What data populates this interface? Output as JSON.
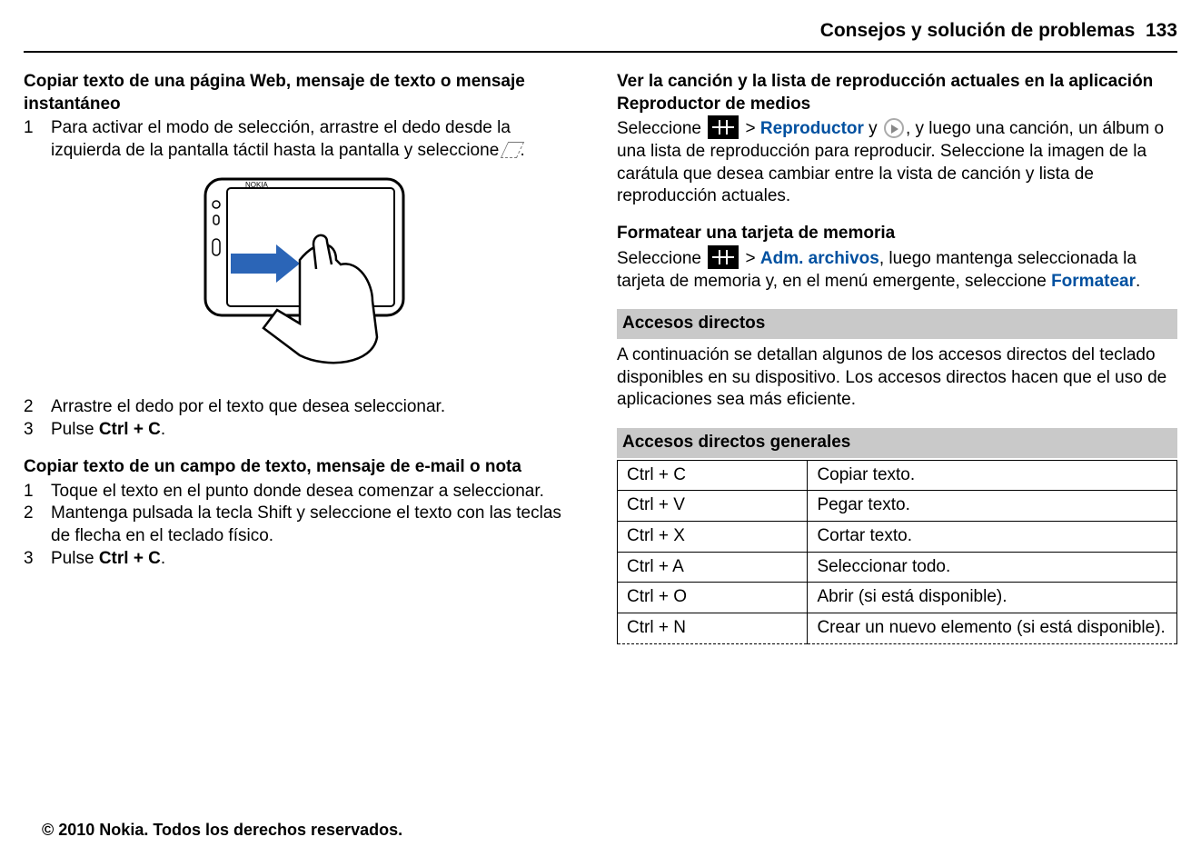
{
  "header": {
    "section": "Consejos y solución de problemas",
    "page": "133"
  },
  "left": {
    "h1": "Copiar texto de una página Web, mensaje de texto o mensaje instantáneo",
    "step1": "Para activar el modo de selección, arrastre el dedo desde la izquierda de la pantalla táctil hasta la pantalla y seleccione ",
    "step2": "Arrastre el dedo por el texto que desea seleccionar.",
    "step3a": "Pulse ",
    "step3b": "Ctrl + C",
    "h2": "Copiar texto de un campo de texto, mensaje de e-mail o nota",
    "b_step1": "Toque el texto en el punto donde desea comenzar a seleccionar.",
    "b_step2": "Mantenga pulsada la tecla Shift y seleccione el texto con las teclas de flecha en el teclado físico.",
    "b_step3a": "Pulse ",
    "b_step3b": "Ctrl + C"
  },
  "right": {
    "h1": "Ver la canción y la lista de reproducción actuales en la aplicación Reproductor de medios",
    "p1a": "Seleccione ",
    "p1b": " > ",
    "p1_rep": "Reproductor",
    "p1c": " y ",
    "p1d": ", y luego una canción, un álbum o una lista de reproducción para reproducir. Seleccione la imagen de la carátula que desea cambiar entre la vista de canción y lista de reproducción actuales.",
    "h2": "Formatear una tarjeta de memoria",
    "p2a": "Seleccione ",
    "p2b": " > ",
    "p2_adm": "Adm. archivos",
    "p2c": ", luego mantenga seleccionada la tarjeta de memoria y, en el menú emergente, seleccione ",
    "p2_fmt": "Formatear",
    "bar1": "Accesos directos",
    "intro": "A continuación se detallan algunos de los accesos directos del teclado disponibles en su dispositivo. Los accesos directos hacen que el uso de aplicaciones sea más eficiente.",
    "bar2": "Accesos directos generales",
    "shortcuts": [
      {
        "k": "Ctrl + C",
        "d": "Copiar texto."
      },
      {
        "k": "Ctrl + V",
        "d": "Pegar texto."
      },
      {
        "k": "Ctrl + X",
        "d": "Cortar texto."
      },
      {
        "k": "Ctrl + A",
        "d": "Seleccionar todo."
      },
      {
        "k": "Ctrl + O",
        "d": "Abrir (si está disponible)."
      },
      {
        "k": "Ctrl + N",
        "d": "Crear un nuevo elemento (si está disponible)."
      }
    ]
  },
  "footer": "© 2010 Nokia. Todos los derechos reservados."
}
